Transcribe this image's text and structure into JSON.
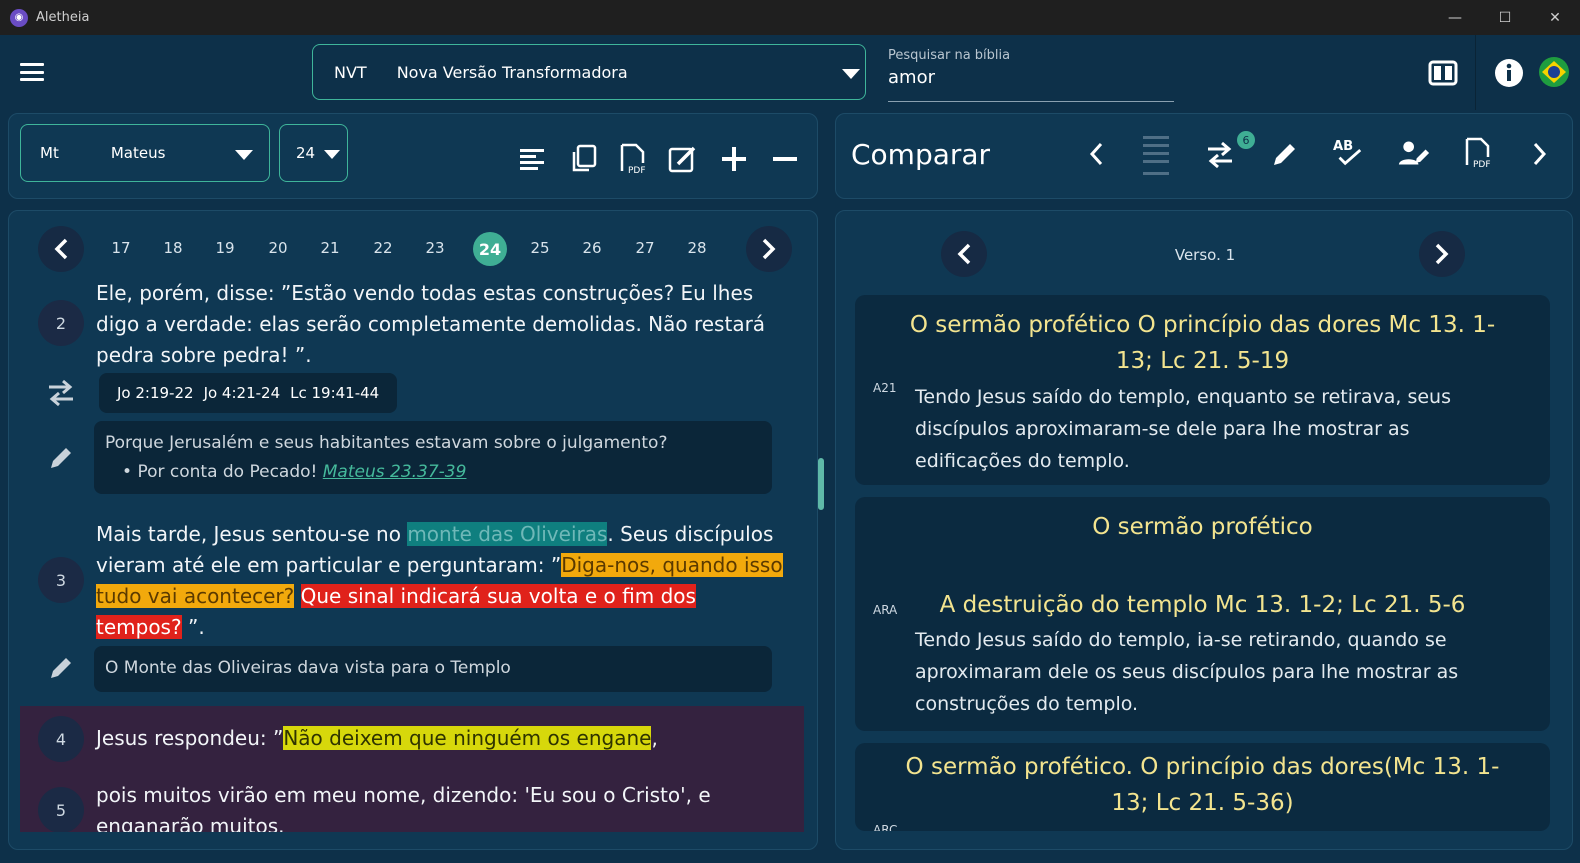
{
  "window": {
    "title": "Aletheia",
    "minimize": "—",
    "maximize": "☐",
    "close": "✕"
  },
  "header": {
    "version_abbr": "NVT",
    "version_name": "Nova Versão Transformadora",
    "search_label": "Pesquisar na bíblia",
    "search_value": "amor"
  },
  "left_toolbar": {
    "book_abbr": "Mt",
    "book_name": "Mateus",
    "chapter": "24"
  },
  "chapters": [
    "17",
    "18",
    "19",
    "20",
    "21",
    "22",
    "23",
    "24",
    "25",
    "26",
    "27",
    "28"
  ],
  "active_chapter": "24",
  "verses": {
    "v2": {
      "num": "2",
      "text": "Ele, porém, disse: ”Estão vendo todas estas construções? Eu lhes digo a verdade: elas serão completamente demolidas. Não restará pedra sobre pedra! ”."
    },
    "xrefs": [
      "Jo 2:19-22",
      "Jo 4:21-24",
      "Lc 19:41-44"
    ],
    "note1": {
      "text": "Porque Jerusalém e seus habitantes estavam sobre o julgamento?",
      "bullet": "Por conta do Pecado!",
      "link": "Mateus 23.37-39"
    },
    "v3": {
      "num": "3",
      "p1": "Mais tarde, Jesus sentou-se no ",
      "h1": "monte das Oliveiras",
      "p2": ". Seus discípulos vieram até ele em particular e perguntaram: ”",
      "h2": "Diga-nos, quando isso tudo vai acontecer?",
      "p3": " ",
      "h3": "Que sinal indicará sua volta e o fim dos tempos?",
      "p4": " ”."
    },
    "note2": {
      "text": "O Monte das Oliveiras dava vista para o Templo"
    },
    "v4": {
      "num": "4",
      "p1": "Jesus respondeu: ”",
      "h1": "Não deixem que ninguém os engane",
      "p2": ","
    },
    "v5": {
      "num": "5",
      "text": "pois muitos virão em meu nome, dizendo: 'Eu sou o Cristo', e enganarão muitos."
    }
  },
  "compare": {
    "title": "Comparar",
    "badge": "6",
    "verse_label": "Verso. 1",
    "cards": [
      {
        "tag": "A21",
        "head": "O sermão profético O princípio das dores  Mc 13. 1-13; Lc 21. 5-19",
        "text": "Tendo Jesus saído do templo, enquanto se retirava, seus discípulos aproximaram-se dele para lhe mostrar as edificações do templo."
      },
      {
        "tag": "ARA",
        "head1": "O sermão profético",
        "head2": "A destruição do templo  Mc 13. 1-2; Lc 21. 5-6",
        "text": "Tendo Jesus saído do templo, ia-se retirando, quando se aproximaram dele os seus discípulos para lhe mostrar as construções do templo."
      },
      {
        "tag": "ARC",
        "head": "O sermão profético. O princípio das dores(Mc 13. 1-13; Lc 21. 5-36)"
      }
    ]
  },
  "colors": {
    "accent": "#3fae94",
    "bg": "#0d3049",
    "hl_teal": "#0f7f7f",
    "hl_orange": "#f2a90c",
    "hl_red": "#e0221b",
    "hl_yellow": "#d7d80b",
    "card_head": "#f3e48f"
  }
}
